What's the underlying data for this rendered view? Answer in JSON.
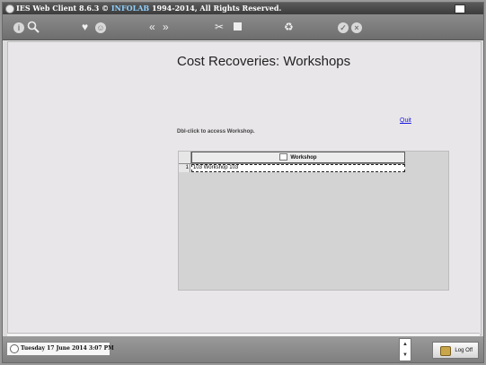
{
  "titlebar": {
    "product": "IES Web Client 8.6.3 ©",
    "company": "INFOLAB",
    "copyright": "1994-2014, All Rights Reserved."
  },
  "toolbar": {
    "icons": [
      "info-icon",
      "search-icon",
      "heart-icon",
      "smiley-icon",
      "back-icon",
      "forward-icon",
      "tools-icon",
      "stop-icon",
      "recycle-icon",
      "confirm-icon",
      "cancel-icon"
    ]
  },
  "page": {
    "title": "Cost Recoveries: Workshops",
    "quit_label": "Quit",
    "hint": "Dbl-click to access Workshop."
  },
  "grid": {
    "column_header": "Workshop",
    "rows": [
      {
        "num": "1",
        "value": "103 Workshop 103"
      }
    ]
  },
  "status": {
    "datetime": "Tuesday 17 June 2014 3:07 PM",
    "logoff_label": "Log Off",
    "spinner_up": "▲",
    "spinner_down": "▼"
  }
}
